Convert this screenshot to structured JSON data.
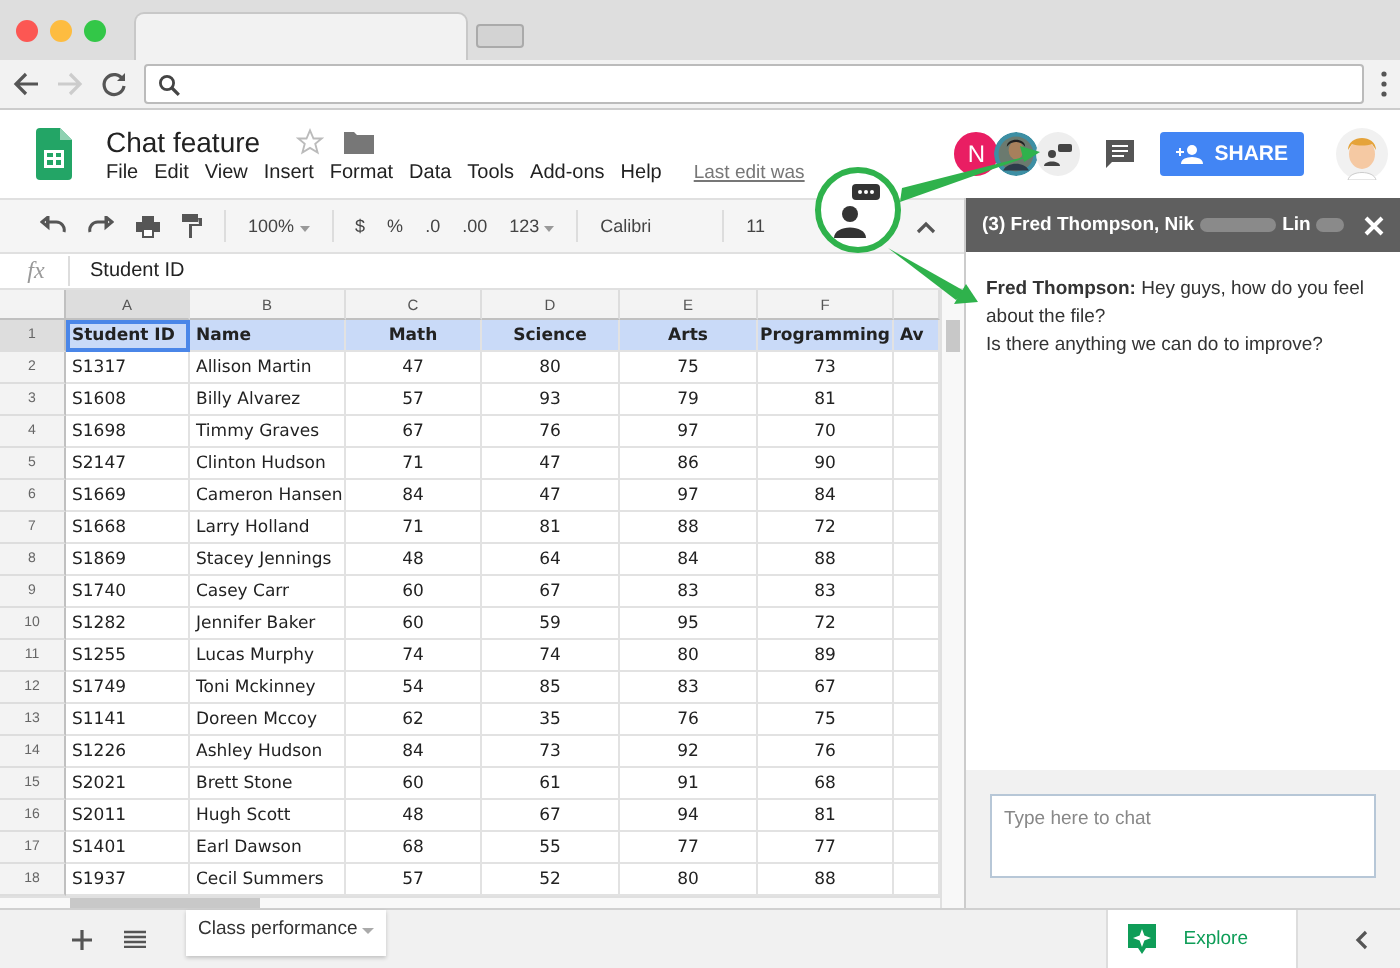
{
  "document": {
    "title": "Chat feature",
    "menu": [
      "File",
      "Edit",
      "View",
      "Insert",
      "Format",
      "Data",
      "Tools",
      "Add-ons",
      "Help"
    ],
    "last_edit": "Last edit was"
  },
  "collaborators": [
    {
      "kind": "initial",
      "initial": "N",
      "color": "#e91e63"
    },
    {
      "kind": "picture"
    }
  ],
  "share_button": "SHARE",
  "toolbar": {
    "zoom": "100%",
    "currency": "$",
    "percent": "%",
    "decrease_decimals": ".0",
    "increase_decimals": ".00",
    "more_formats": "123",
    "font": "Calibri",
    "font_size": "11"
  },
  "formula_bar": {
    "label": "fx",
    "value": "Student ID"
  },
  "sheet": {
    "columns": [
      {
        "label": "A",
        "selected": true
      },
      {
        "label": "B",
        "selected": false
      },
      {
        "label": "C",
        "selected": false
      },
      {
        "label": "D",
        "selected": false
      },
      {
        "label": "E",
        "selected": false
      },
      {
        "label": "F",
        "selected": false
      }
    ],
    "rows": [
      {
        "number": "1",
        "selected": true,
        "cells": [
          "Student ID",
          "Name",
          "Math",
          "Science",
          "Arts",
          "Programming",
          "Av"
        ]
      },
      {
        "number": "2",
        "selected": false,
        "cells": [
          "S1317",
          "Allison Martin",
          "47",
          "80",
          "75",
          "73"
        ]
      },
      {
        "number": "3",
        "selected": false,
        "cells": [
          "S1608",
          "Billy Alvarez",
          "57",
          "93",
          "79",
          "81"
        ]
      },
      {
        "number": "4",
        "selected": false,
        "cells": [
          "S1698",
          "Timmy Graves",
          "67",
          "76",
          "97",
          "70"
        ]
      },
      {
        "number": "5",
        "selected": false,
        "cells": [
          "S2147",
          "Clinton Hudson",
          "71",
          "47",
          "86",
          "90"
        ]
      },
      {
        "number": "6",
        "selected": false,
        "cells": [
          "S1669",
          "Cameron Hansen",
          "84",
          "47",
          "97",
          "84"
        ]
      },
      {
        "number": "7",
        "selected": false,
        "cells": [
          "S1668",
          "Larry Holland",
          "71",
          "81",
          "88",
          "72"
        ]
      },
      {
        "number": "8",
        "selected": false,
        "cells": [
          "S1869",
          "Stacey Jennings",
          "48",
          "64",
          "84",
          "88"
        ]
      },
      {
        "number": "9",
        "selected": false,
        "cells": [
          "S1740",
          "Casey Carr",
          "60",
          "67",
          "83",
          "83"
        ]
      },
      {
        "number": "10",
        "selected": false,
        "cells": [
          "S1282",
          "Jennifer Baker",
          "60",
          "59",
          "95",
          "72"
        ]
      },
      {
        "number": "11",
        "selected": false,
        "cells": [
          "S1255",
          "Lucas Murphy",
          "74",
          "74",
          "80",
          "89"
        ]
      },
      {
        "number": "12",
        "selected": false,
        "cells": [
          "S1749",
          "Toni Mckinney",
          "54",
          "85",
          "83",
          "67"
        ]
      },
      {
        "number": "13",
        "selected": false,
        "cells": [
          "S1141",
          "Doreen Mccoy",
          "62",
          "35",
          "76",
          "75"
        ]
      },
      {
        "number": "14",
        "selected": false,
        "cells": [
          "S1226",
          "Ashley Hudson",
          "84",
          "73",
          "92",
          "76"
        ]
      },
      {
        "number": "15",
        "selected": false,
        "cells": [
          "S2021",
          "Brett Stone",
          "60",
          "61",
          "91",
          "68"
        ]
      },
      {
        "number": "16",
        "selected": false,
        "cells": [
          "S2011",
          "Hugh Scott",
          "48",
          "67",
          "94",
          "81"
        ]
      },
      {
        "number": "17",
        "selected": false,
        "cells": [
          "S1401",
          "Earl Dawson",
          "68",
          "55",
          "77",
          "77"
        ]
      },
      {
        "number": "18",
        "selected": false,
        "cells": [
          "S1937",
          "Cecil Summers",
          "57",
          "52",
          "80",
          "88"
        ]
      }
    ]
  },
  "chat": {
    "title_parts": [
      "(3) Fred Thompson, Nik",
      "Lin"
    ],
    "messages": [
      "**Fred Thompson:** Hey guys, how do you feel about the file?",
      "Is there anything we can do to improve?"
    ],
    "input": {
      "placeholder": "Type here to chat"
    }
  },
  "bottom_bar": {
    "sheet_tabs": [
      {
        "label": "Class performance",
        "selected": true
      }
    ],
    "explore": "Explore"
  }
}
